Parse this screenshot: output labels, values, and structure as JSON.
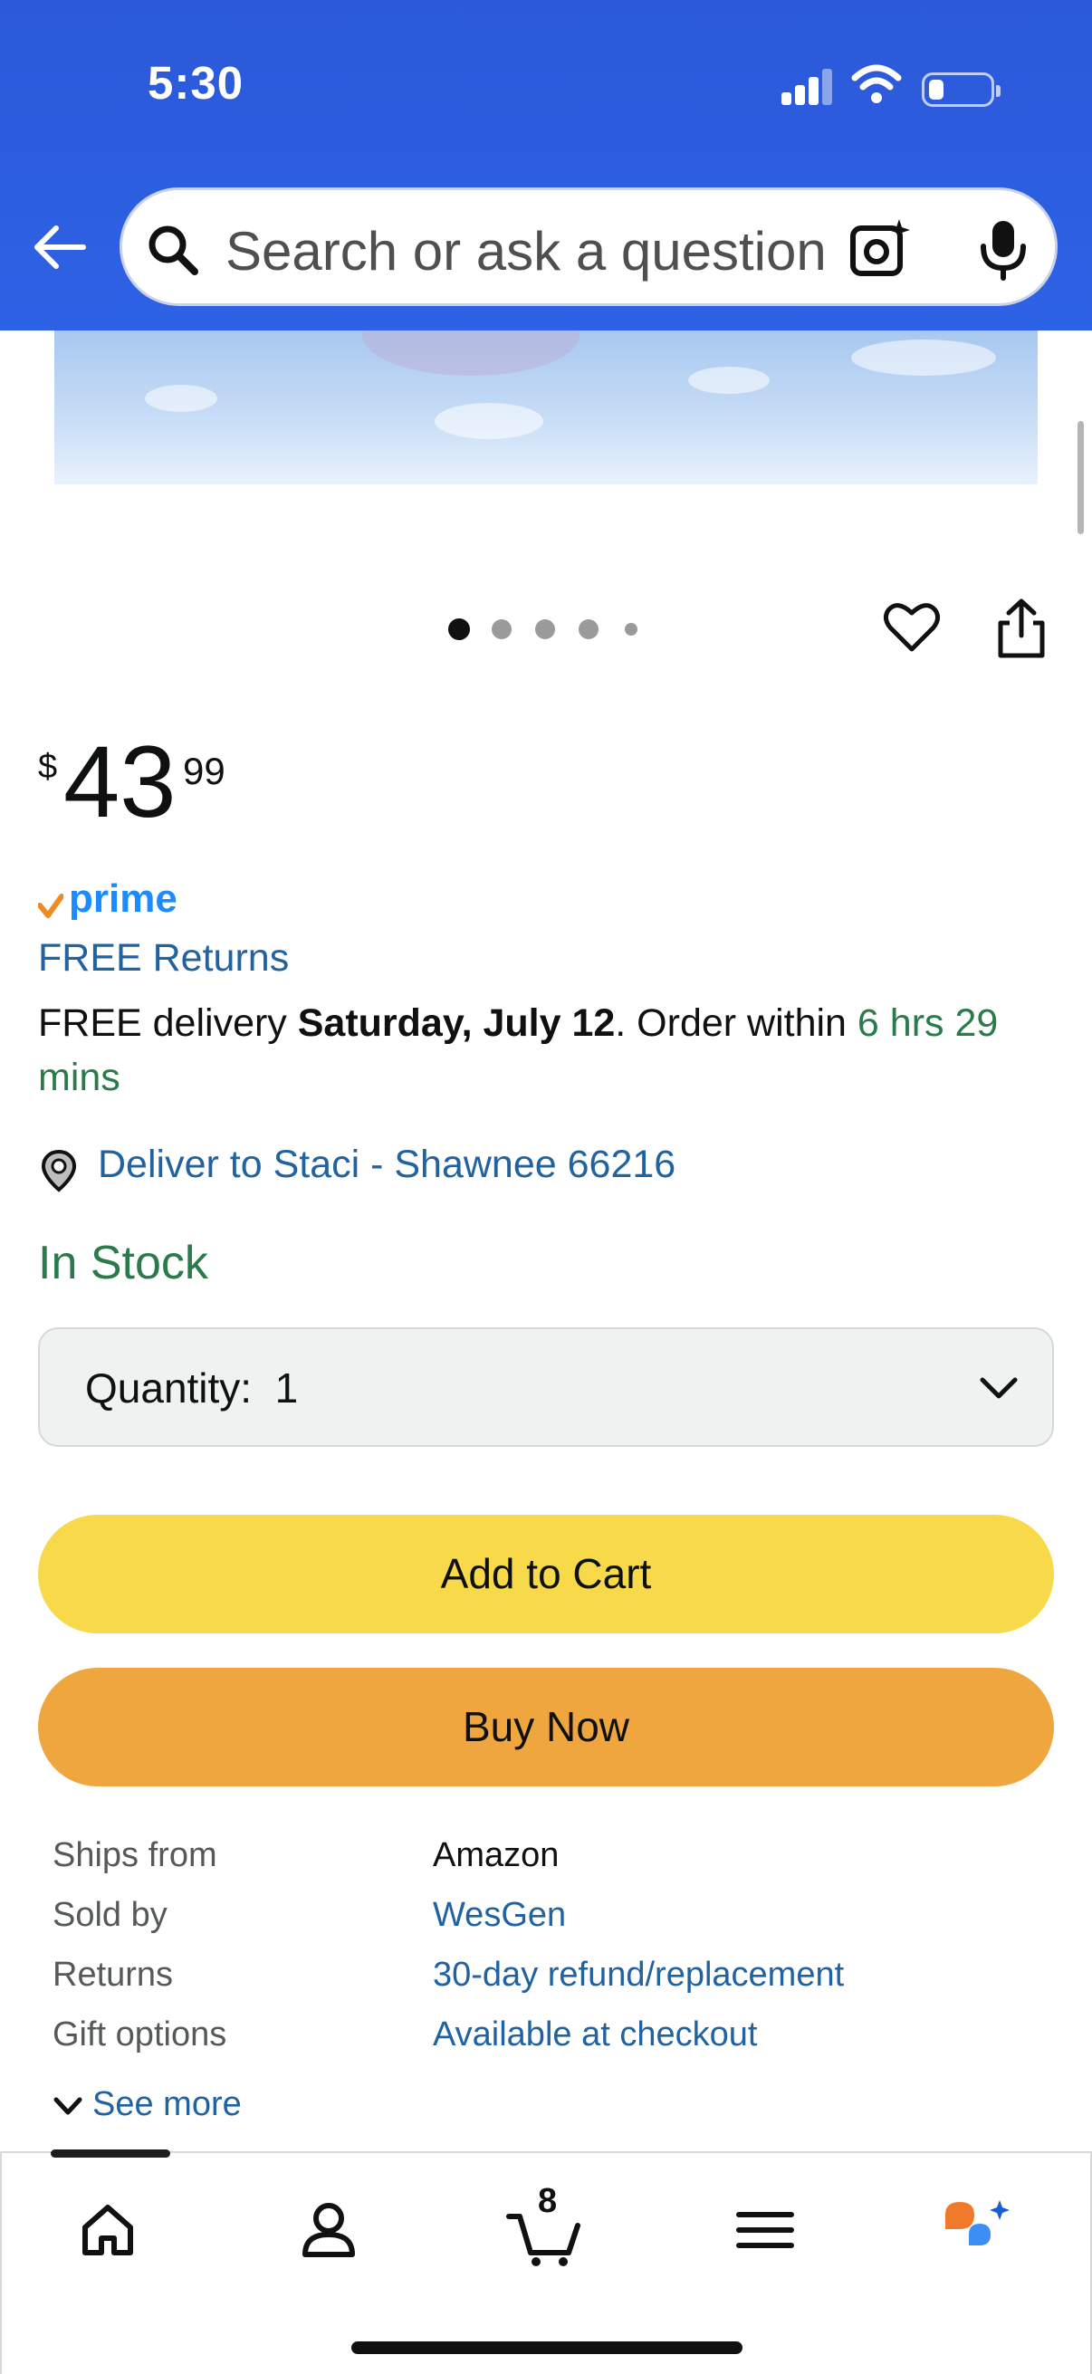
{
  "status_bar": {
    "time": "5:30"
  },
  "header": {
    "search_placeholder": "Search or ask a question"
  },
  "gallery": {
    "image_count": 5,
    "active_index": 0
  },
  "price": {
    "currency": "$",
    "whole": "43",
    "fraction": "99"
  },
  "prime": {
    "label": "prime"
  },
  "free_returns": "FREE Returns",
  "delivery": {
    "prefix": "FREE delivery ",
    "date": "Saturday, July 12",
    "middle": ". Order within ",
    "countdown": "6 hrs 29 mins"
  },
  "deliver_to": "Deliver to Staci - Shawnee 66216",
  "stock_status": "In Stock",
  "quantity": {
    "label": "Quantity:",
    "value": "1"
  },
  "buttons": {
    "add_to_cart": "Add to Cart",
    "buy_now": "Buy Now"
  },
  "details": [
    {
      "key": "Ships from",
      "value": "Amazon",
      "is_link": false
    },
    {
      "key": "Sold by",
      "value": "WesGen",
      "is_link": true
    },
    {
      "key": "Returns",
      "value": "30-day refund/replacement",
      "is_link": true
    },
    {
      "key": "Gift options",
      "value": "Available at checkout",
      "is_link": true
    }
  ],
  "see_more": "See more",
  "bottom_nav": {
    "items": [
      "home-icon",
      "account-icon",
      "cart-icon",
      "menu-icon",
      "rufus-icon"
    ],
    "cart_count": "8"
  },
  "colors": {
    "header_blue": "#2c5ee0",
    "link_blue": "#2162a1",
    "in_stock_green": "#2b7a4b",
    "add_to_cart_yellow": "#f7d94a",
    "buy_now_orange": "#f0a63f",
    "prime_blue": "#1a8cff"
  }
}
